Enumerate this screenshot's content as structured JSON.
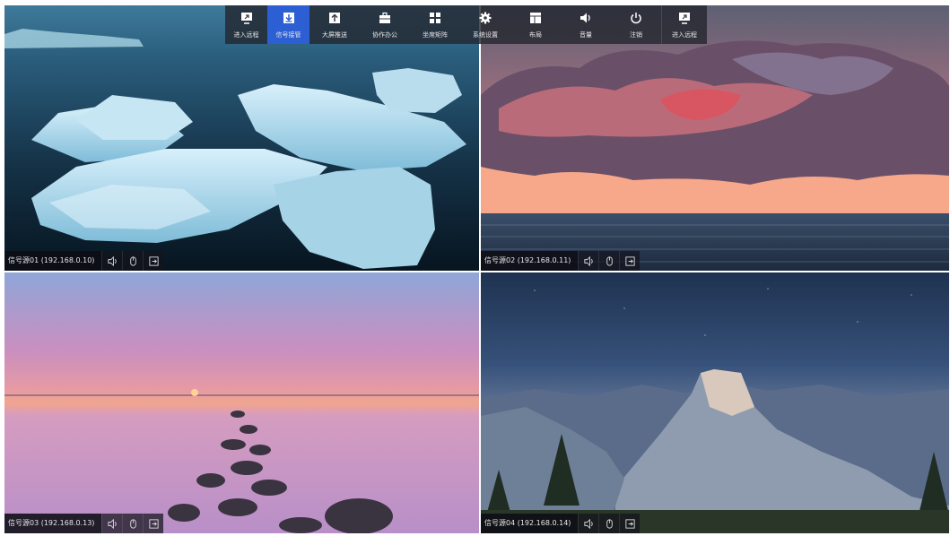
{
  "toolbar": {
    "items": [
      {
        "label": "进入远程",
        "icon": "remote-enter-icon"
      },
      {
        "label": "信号接管",
        "icon": "download-icon",
        "active": true
      },
      {
        "label": "大屏推送",
        "icon": "upload-icon"
      },
      {
        "label": "协作办公",
        "icon": "briefcase-icon"
      },
      {
        "label": "坐席矩阵",
        "icon": "grid-icon"
      },
      {
        "label": "系统设置",
        "icon": "gear-icon"
      },
      {
        "label": "布局",
        "icon": "layout-icon"
      },
      {
        "label": "音量",
        "icon": "volume-icon"
      },
      {
        "label": "注销",
        "icon": "power-icon"
      },
      {
        "label": "进入远程",
        "icon": "remote-enter-icon"
      }
    ],
    "active_color": "#2c5fd4"
  },
  "sources": [
    {
      "label": "信号源01 (192.168.0.10)"
    },
    {
      "label": "信号源02 (192.168.0.11)"
    },
    {
      "label": "信号源03 (192.168.0.13)"
    },
    {
      "label": "信号源04 (192.168.0.14)"
    }
  ]
}
